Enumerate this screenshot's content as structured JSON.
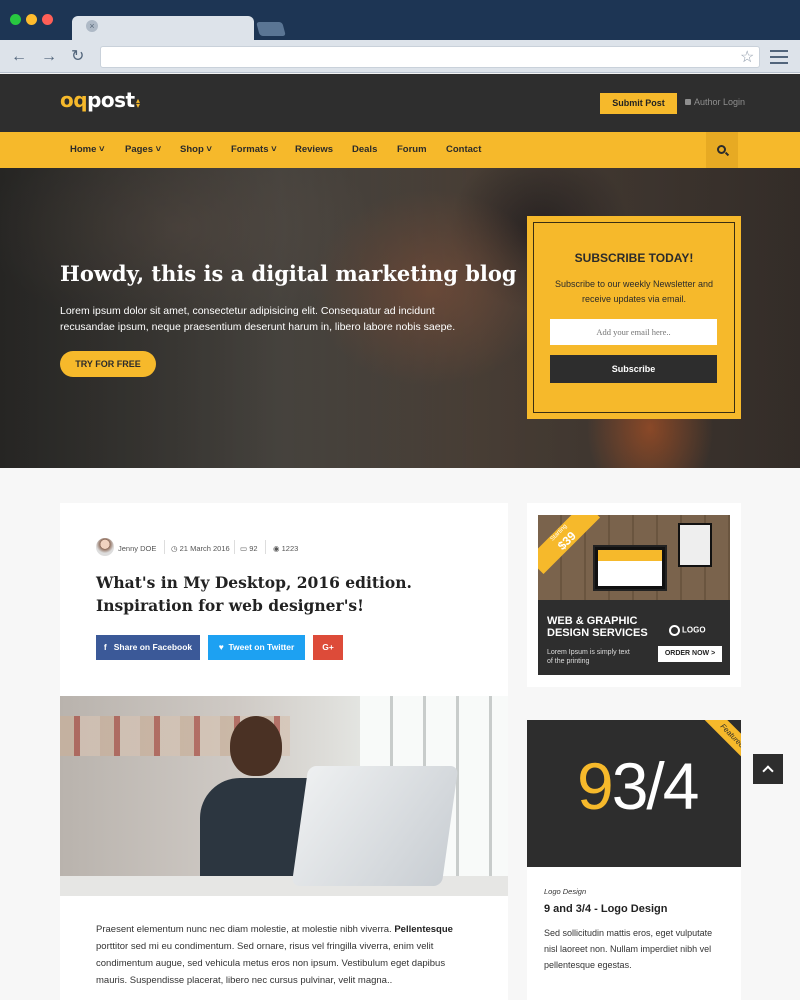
{
  "browser": {
    "url": "",
    "dots": [
      "#28c840",
      "#febc2e",
      "#ff5f57"
    ]
  },
  "header": {
    "logo_prefix": "oq",
    "logo_suffix": "post",
    "submit_label": "Submit Post",
    "login_label": "Author Login"
  },
  "nav": {
    "items": [
      {
        "label": "Home",
        "has_dropdown": true
      },
      {
        "label": "Pages",
        "has_dropdown": true
      },
      {
        "label": "Shop",
        "has_dropdown": true
      },
      {
        "label": "Formats",
        "has_dropdown": true
      },
      {
        "label": "Reviews",
        "has_dropdown": false
      },
      {
        "label": "Deals",
        "has_dropdown": false
      },
      {
        "label": "Forum",
        "has_dropdown": false
      },
      {
        "label": "Contact",
        "has_dropdown": false
      }
    ],
    "home_label": "Home ˅",
    "pages_label": "Pages ˅",
    "shop_label": "Shop ˅",
    "formats_label": "Formats ˅",
    "reviews_label": "Reviews",
    "deals_label": "Deals",
    "forum_label": "Forum",
    "contact_label": "Contact"
  },
  "hero": {
    "title": "Howdy, this is a digital marketing blog",
    "text": "Lorem ipsum dolor sit amet, consectetur adipisicing elit. Consequatur ad incidunt recusandae ipsum, neque praesentium deserunt harum in, libero labore nobis saepe.",
    "button_label": "TRY FOR FREE"
  },
  "subscribe": {
    "title": "SUBSCRIBE TODAY!",
    "text": "Subscribe to our weekly Newsletter and receive updates via email.",
    "placeholder": "Add your email here..",
    "button_label": "Subscribe"
  },
  "post": {
    "author": "Jenny DOE",
    "date": "21 March 2016",
    "comments": "92",
    "views": "1223",
    "title": "What's in My Desktop, 2016 edition. Inspiration for web designer's!",
    "share_facebook": "Share on Facebook",
    "share_twitter": "Tweet on Twitter",
    "share_google": "G+",
    "excerpt_before": "Praesent elementum nunc nec diam molestie, at molestie nibh viverra. ",
    "excerpt_bold": "Pellentesque",
    "excerpt_after": " porttitor sed mi eu condimentum. Sed ornare, risus vel fringilla viverra, enim velit condimentum augue, sed vehicula metus eros non ipsum. Vestibulum eget dapibus mauris. Suspendisse placerat, libero nec cursus pulvinar, velit magna.."
  },
  "ad": {
    "ribbon_small": "Starting",
    "ribbon_price": "$39",
    "title": "WEB & GRAPHIC DESIGN SERVICES",
    "subtitle": "Lorem Ipsum is simply text of the printing",
    "logo": "LOGO",
    "order_label": "ORDER NOW >"
  },
  "featured": {
    "ribbon": "Featured",
    "image_number_gold": "9",
    "image_number_rest": "3/4",
    "category": "Logo Design",
    "title": "9 and 3/4 - Logo Design",
    "text": "Sed sollicitudin mattis eros, eget vulputate nisl laoreet non. Nullam imperdiet nibh vel pellentesque egestas."
  },
  "icons": {
    "accent": "#f6b92b",
    "dark": "#2e2e2e"
  }
}
